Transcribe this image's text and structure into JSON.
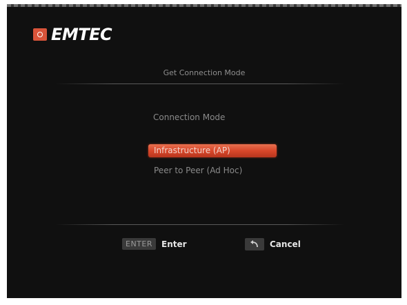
{
  "brand": {
    "name": "EMTEC",
    "accent_color": "#d9543a"
  },
  "screen": {
    "title": "Get Connection Mode",
    "section_label": "Connection Mode"
  },
  "options": [
    {
      "label": "Infrastructure (AP)",
      "selected": true
    },
    {
      "label": "Peer to Peer (Ad Hoc)",
      "selected": false
    }
  ],
  "footer": {
    "enter_key": "ENTER",
    "enter_label": "Enter",
    "cancel_icon": "back-arrow-icon",
    "cancel_label": "Cancel"
  },
  "colors": {
    "background": "#101010",
    "selection": "#d9472a",
    "text_dim": "#8a8a8a",
    "text_bright": "#e6e6e6"
  }
}
